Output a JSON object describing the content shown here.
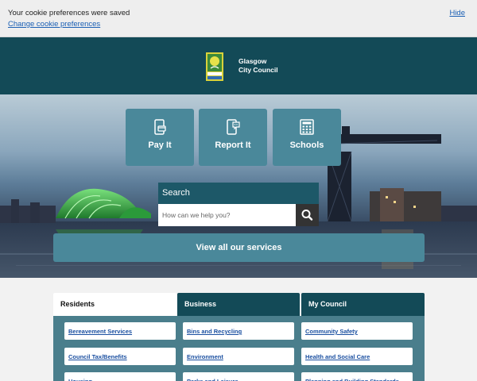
{
  "cookie_banner": {
    "message": "Your cookie preferences were saved",
    "change_link": "Change cookie preferences",
    "hide_link": "Hide"
  },
  "header": {
    "logo_text_line1": "Glasgow",
    "logo_text_line2": "City Council",
    "background_color": "#134a57"
  },
  "hero": {
    "tiles": [
      {
        "label": "Pay It",
        "icon": "phone-payment-icon"
      },
      {
        "label": "Report It",
        "icon": "phone-report-icon"
      },
      {
        "label": "Schools",
        "icon": "calculator-icon"
      }
    ],
    "search": {
      "title": "Search",
      "placeholder": "How can we help you?",
      "button_icon": "search-icon"
    },
    "view_all_label": "View all our services"
  },
  "tabs": [
    {
      "label": "Residents",
      "active": true
    },
    {
      "label": "Business",
      "active": false
    },
    {
      "label": "My Council",
      "active": false
    }
  ],
  "services": [
    [
      "Bereavement Services",
      "Bins and Recycling",
      "Community Safety"
    ],
    [
      "Council Tax/Benefits",
      "Environment",
      "Health and Social Care"
    ],
    [
      "Housing",
      "Parks and Leisure",
      "Planning and Building Standards"
    ]
  ],
  "colors": {
    "accent_tile": "#4a889a",
    "dark_teal": "#134a57",
    "link_blue": "#1a4fa0"
  }
}
